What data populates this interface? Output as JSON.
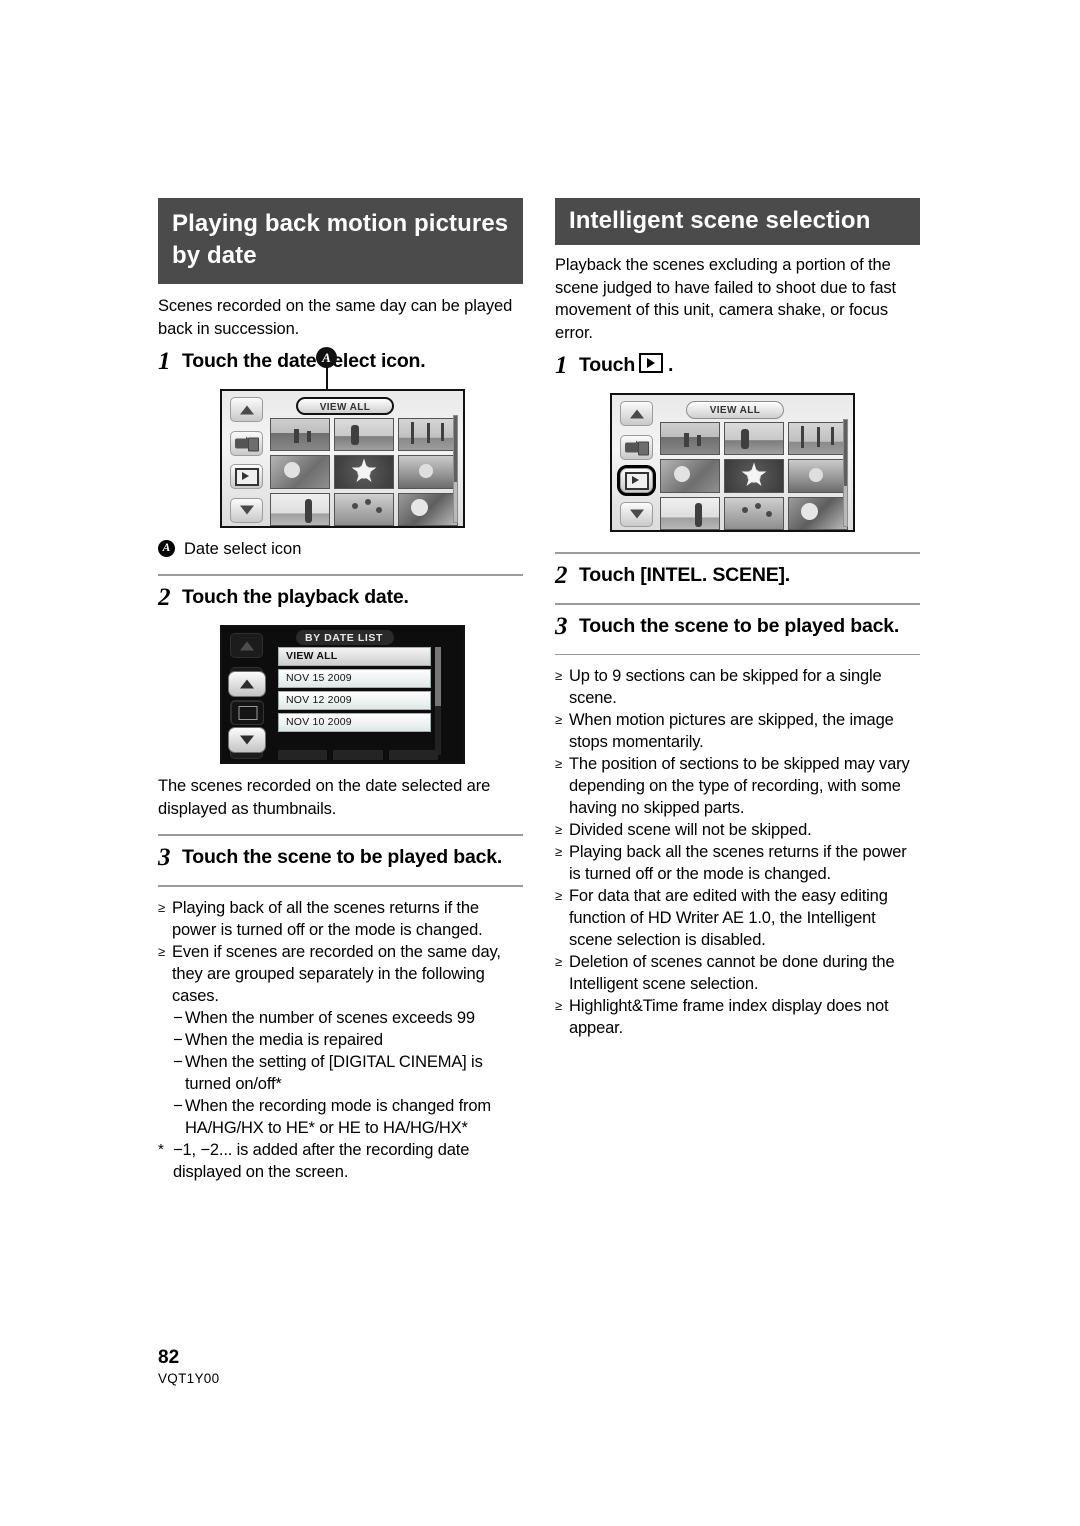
{
  "document": {
    "page_number": "82",
    "doc_code": "VQT1Y00"
  },
  "left_column": {
    "section_title": "Playing back motion pictures by date",
    "intro": "Scenes recorded on the same day can be played back in succession.",
    "step1": {
      "num": "1",
      "text": "Touch the date select icon."
    },
    "figure1": {
      "view_all_label": "VIEW ALL",
      "callout_letter": "A",
      "icons": [
        "up-arrow",
        "media-select",
        "play-mode",
        "down-arrow"
      ]
    },
    "callout_a": {
      "letter": "A",
      "text": "Date select icon"
    },
    "step2": {
      "num": "2",
      "text": "Touch the playback date."
    },
    "figure2": {
      "title": "BY DATE LIST",
      "ghost_label": "VIEW ALL",
      "rows": [
        "VIEW ALL",
        "NOV 15  2009",
        "NOV 12  2009",
        "NOV 10  2009"
      ]
    },
    "after_fig2": "The scenes recorded on the date selected are displayed as thumbnails.",
    "step3": {
      "num": "3",
      "text": "Touch the scene to be played back."
    },
    "bullets": [
      "Playing back of all the scenes returns if the power is turned off or the mode is changed.",
      "Even if scenes are recorded on the same day, they are grouped separately in the following cases."
    ],
    "sub_bullets": [
      "When the number of scenes exceeds 99",
      "When the media is repaired",
      "When the setting of [DIGITAL CINEMA] is turned on/off*",
      "When the recording mode is changed from HA/HG/HX to HE* or HE to HA/HG/HX*"
    ],
    "footnote": "−1, −2... is added after the recording date displayed on the screen.",
    "footnote_mark": "*"
  },
  "right_column": {
    "section_title": "Intelligent scene selection",
    "intro": "Playback the scenes excluding a portion of the scene judged to have failed to shoot due to fast movement of this unit, camera shake, or focus error.",
    "step1": {
      "num": "1",
      "before": "Touch",
      "icon": "play-mode-icon",
      "after": "."
    },
    "figure1": {
      "view_all_label": "VIEW ALL",
      "highlighted_icon": "play-mode"
    },
    "step2": {
      "num": "2",
      "text": "Touch [INTEL. SCENE]."
    },
    "step3": {
      "num": "3",
      "text": "Touch the scene to be played back."
    },
    "bullets": [
      "Up to 9 sections can be skipped for a single scene.",
      "When motion pictures are skipped, the image stops momentarily.",
      "The position of sections to be skipped may vary depending on the type of recording, with some having no skipped parts.",
      "Divided scene will not be skipped.",
      "Playing back all the scenes returns if the power is turned off or the mode is changed.",
      "For data that are edited with the easy editing function of HD Writer AE 1.0, the Intelligent scene selection is disabled.",
      "Deletion of scenes cannot be done during the Intelligent scene selection.",
      "Highlight&Time frame index display does not appear."
    ]
  },
  "symbols": {
    "bullet_mark": "≥",
    "dash_mark": "−"
  }
}
